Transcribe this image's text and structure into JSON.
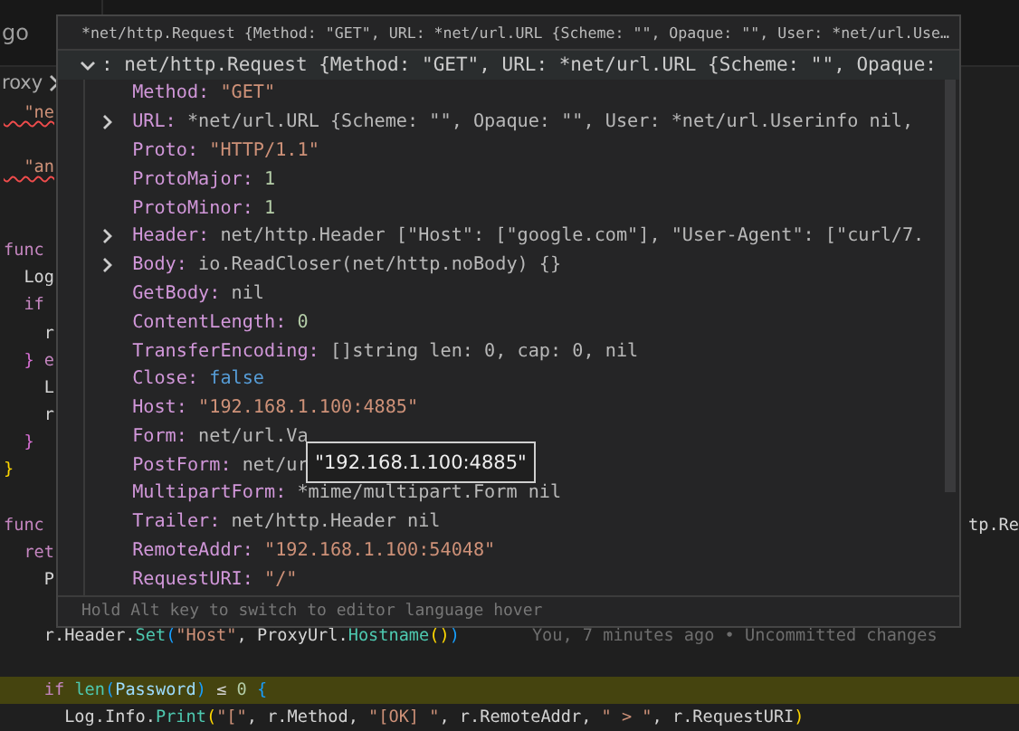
{
  "editor_tab": {
    "label": "go"
  },
  "breadcrumb": {
    "label": "roxy"
  },
  "code_lines": [
    {
      "kind": "code",
      "highlighted": false,
      "segments": [
        {
          "text": "  \"ne",
          "kind": "string",
          "error": true
        }
      ]
    },
    {
      "kind": "blank"
    },
    {
      "kind": "code",
      "highlighted": false,
      "segments": [
        {
          "text": "  \"an",
          "kind": "string",
          "error": true
        }
      ]
    },
    {
      "kind": "blank"
    },
    {
      "kind": "blank"
    },
    {
      "kind": "code",
      "highlighted": false,
      "segments": [
        {
          "text": "func",
          "kind": "keyword"
        }
      ]
    },
    {
      "kind": "code",
      "highlighted": false,
      "segments": [
        {
          "text": "  Log",
          "kind": "plain"
        }
      ]
    },
    {
      "kind": "code",
      "highlighted": false,
      "segments": [
        {
          "text": "  if",
          "kind": "keyword"
        }
      ]
    },
    {
      "kind": "code",
      "highlighted": false,
      "segments": [
        {
          "text": "    r",
          "kind": "plain"
        }
      ]
    },
    {
      "kind": "code",
      "highlighted": false,
      "segments": [
        {
          "text": "  }",
          "kind": "bracket2"
        },
        {
          "text": " e",
          "kind": "keyword"
        }
      ]
    },
    {
      "kind": "code",
      "highlighted": false,
      "segments": [
        {
          "text": "    L",
          "kind": "plain"
        }
      ]
    },
    {
      "kind": "code",
      "highlighted": false,
      "segments": [
        {
          "text": "    r",
          "kind": "plain"
        }
      ]
    },
    {
      "kind": "code",
      "highlighted": false,
      "segments": [
        {
          "text": "  }",
          "kind": "bracket2"
        }
      ]
    },
    {
      "kind": "code",
      "highlighted": false,
      "segments": [
        {
          "text": "}",
          "kind": "bracket1"
        }
      ]
    },
    {
      "kind": "blank"
    },
    {
      "kind": "code",
      "highlighted": false,
      "segments": [
        {
          "text": "func",
          "kind": "keyword"
        }
      ],
      "right": "tp.Re"
    },
    {
      "kind": "code",
      "highlighted": false,
      "segments": [
        {
          "text": "  ret",
          "kind": "keyword"
        }
      ]
    },
    {
      "kind": "code",
      "highlighted": false,
      "segments": [
        {
          "text": "    P",
          "kind": "plain"
        }
      ]
    },
    {
      "kind": "blank"
    },
    {
      "kind": "code",
      "highlighted": false,
      "segments": [
        {
          "text": "    r.Header.",
          "kind": "plain"
        },
        {
          "text": "Set",
          "kind": "function"
        },
        {
          "text": "(",
          "kind": "bracket3"
        },
        {
          "text": "\"Host\"",
          "kind": "string"
        },
        {
          "text": ", ProxyUrl.",
          "kind": "plain"
        },
        {
          "text": "Hostname",
          "kind": "function"
        },
        {
          "text": "()",
          "kind": "bracket1"
        },
        {
          "text": ")",
          "kind": "bracket3"
        }
      ],
      "blame": "You, 7 minutes ago • Uncommitted changes"
    },
    {
      "kind": "blank"
    },
    {
      "kind": "code",
      "highlighted": true,
      "segments": [
        {
          "text": "    if ",
          "kind": "keyword"
        },
        {
          "text": "len",
          "kind": "function"
        },
        {
          "text": "(",
          "kind": "bracket3"
        },
        {
          "text": "Password",
          "kind": "variable"
        },
        {
          "text": ")",
          "kind": "bracket3"
        },
        {
          "text": " ≤ ",
          "kind": "plain"
        },
        {
          "text": "0",
          "kind": "number"
        },
        {
          "text": " {",
          "kind": "bracket3"
        }
      ]
    },
    {
      "kind": "code",
      "highlighted": false,
      "segments": [
        {
          "text": "      Log.Info.",
          "kind": "plain"
        },
        {
          "text": "Print",
          "kind": "function"
        },
        {
          "text": "(",
          "kind": "bracket1"
        },
        {
          "text": "\"[\"",
          "kind": "string"
        },
        {
          "text": ", r.Method, ",
          "kind": "plain"
        },
        {
          "text": "\"[OK] \"",
          "kind": "string"
        },
        {
          "text": ", r.RemoteAddr, ",
          "kind": "plain"
        },
        {
          "text": "\" > \"",
          "kind": "string"
        },
        {
          "text": ", r.RequestURI",
          "kind": "plain"
        },
        {
          "text": ")",
          "kind": "bracket1"
        }
      ]
    }
  ],
  "hover": {
    "title": "*net/http.Request {Method: \"GET\", URL: *net/url.URL {Scheme: \"\", Opaque: \"\", User: *net/url.Use…",
    "root": {
      "label": ": net/http.Request {Method: \"GET\", URL: *net/url.URL {Scheme: \"\", Opaque:",
      "expanded": true
    },
    "items": [
      {
        "key": "Method:",
        "value": "\"GET\"",
        "kind": "string"
      },
      {
        "key": "URL:",
        "value": "*net/url.URL {Scheme: \"\", Opaque: \"\", User: *net/url.Userinfo nil,",
        "kind": "type",
        "expanded": false
      },
      {
        "key": "Proto:",
        "value": "\"HTTP/1.1\"",
        "kind": "string"
      },
      {
        "key": "ProtoMajor:",
        "value": "1",
        "kind": "number"
      },
      {
        "key": "ProtoMinor:",
        "value": "1",
        "kind": "number"
      },
      {
        "key": "Header:",
        "value": "net/http.Header [\"Host\": [\"google.com\"], \"User-Agent\": [\"curl/7.",
        "kind": "type",
        "expanded": false
      },
      {
        "key": "Body:",
        "value": "io.ReadCloser(net/http.noBody) {}",
        "kind": "type",
        "expanded": false
      },
      {
        "key": "GetBody:",
        "value": "nil",
        "kind": "type"
      },
      {
        "key": "ContentLength:",
        "value": "0",
        "kind": "number"
      },
      {
        "key": "TransferEncoding:",
        "value": "[]string len: 0, cap: 0, nil",
        "kind": "type"
      },
      {
        "key": "Close:",
        "value": "false",
        "kind": "bool"
      },
      {
        "key": "Host:",
        "value": "\"192.168.1.100:4885\"",
        "kind": "string"
      },
      {
        "key": "Form:",
        "value": "net/url.Va",
        "kind": "type"
      },
      {
        "key": "PostForm:",
        "value": "net/ur",
        "kind": "type"
      },
      {
        "key": "MultipartForm:",
        "value": "*mime/multipart.Form nil",
        "kind": "type"
      },
      {
        "key": "Trailer:",
        "value": "net/http.Header nil",
        "kind": "type"
      },
      {
        "key": "RemoteAddr:",
        "value": "\"192.168.1.100:54048\"",
        "kind": "string"
      },
      {
        "key": "RequestURI:",
        "value": "\"/\"",
        "kind": "string"
      }
    ],
    "footer": "Hold Alt key to switch to editor language hover"
  },
  "tooltip": {
    "text": "\"192.168.1.100:4885\""
  }
}
